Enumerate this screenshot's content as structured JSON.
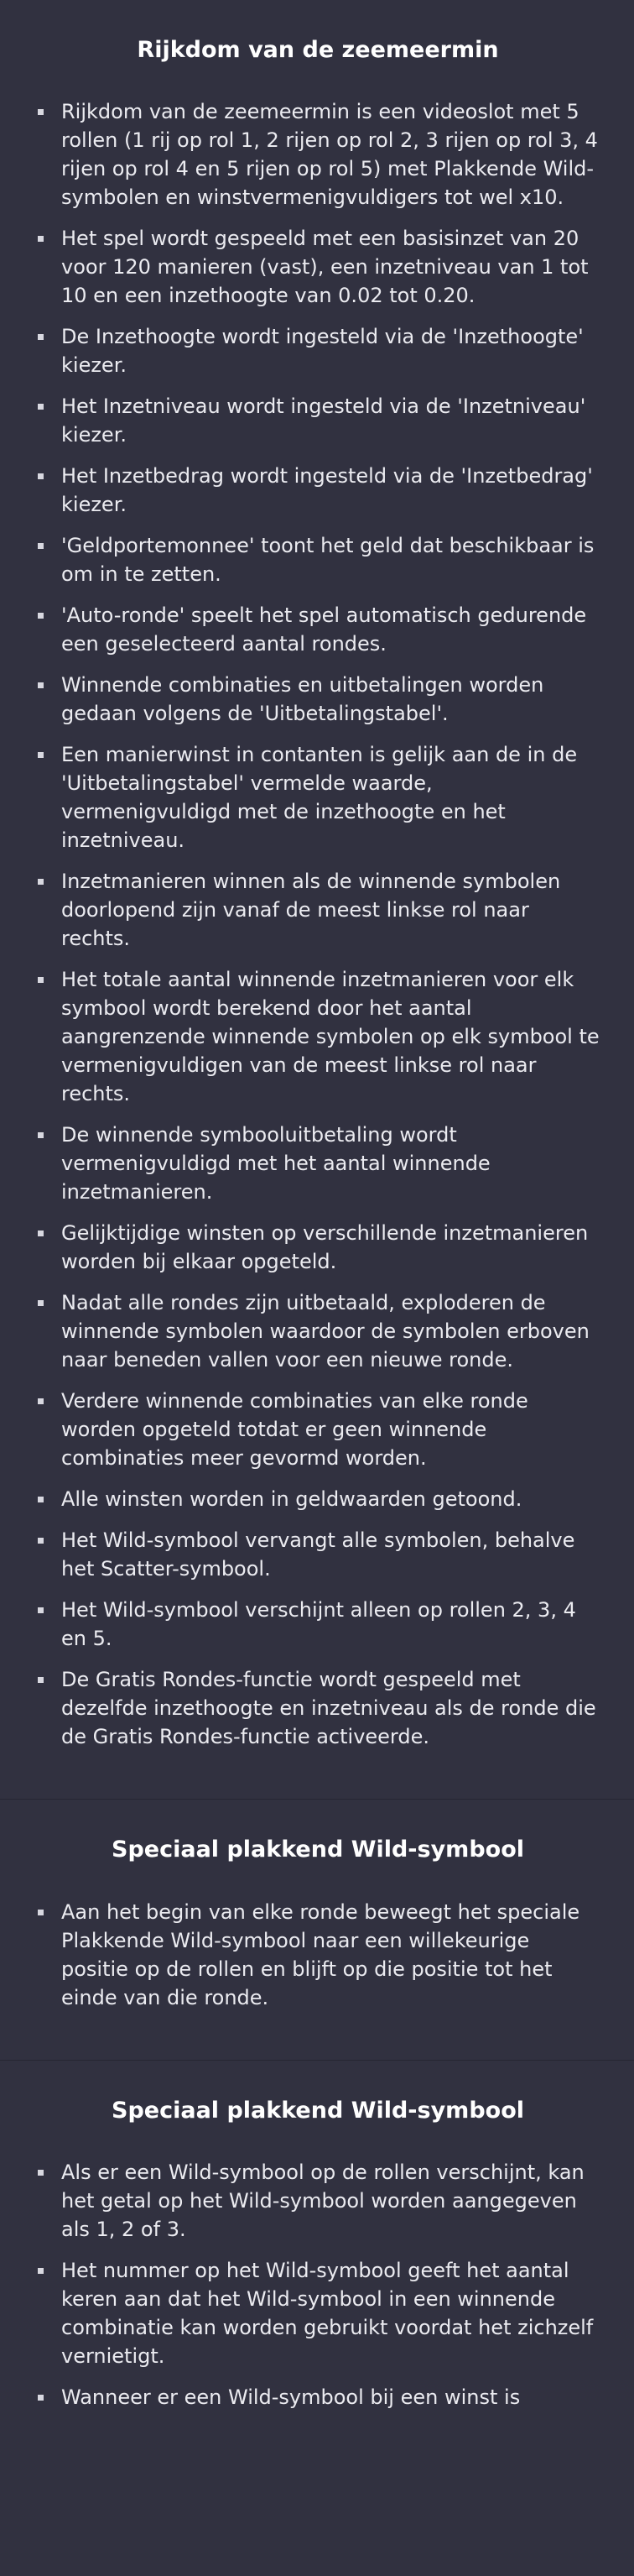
{
  "sections": [
    {
      "title": "Rijkdom van de zeemeermin",
      "items": [
        "Rijkdom van de zeemeermin is een videoslot met 5 rollen (1 rij op rol 1, 2 rijen op rol 2, 3 rijen op rol 3, 4 rijen op rol 4 en 5 rijen op rol 5) met Plakkende Wild-symbolen en winstvermenigvuldigers tot wel x10.",
        "Het spel wordt gespeeld met een basisinzet van 20 voor 120 manieren (vast), een inzetniveau van 1 tot 10 en een inzethoogte van 0.02 tot 0.20.",
        "De Inzethoogte wordt ingesteld via de 'Inzethoogte' kiezer.",
        "Het Inzetniveau wordt ingesteld via de 'Inzetniveau' kiezer.",
        "Het Inzetbedrag wordt ingesteld via de 'Inzetbedrag' kiezer.",
        "'Geldportemonnee' toont het geld dat beschikbaar is om in te zetten.",
        "'Auto-ronde' speelt het spel automatisch gedurende een geselecteerd aantal rondes.",
        "Winnende combinaties en uitbetalingen worden gedaan volgens de 'Uitbetalingstabel'.",
        "Een manierwinst in contanten is gelijk aan de in de 'Uitbetalingstabel' vermelde waarde, vermenigvuldigd met de inzethoogte en het inzetniveau.",
        "Inzetmanieren winnen als de winnende symbolen doorlopend zijn vanaf de meest linkse rol naar rechts.",
        "Het totale aantal winnende inzetmanieren voor elk symbool wordt berekend door het aantal aangrenzende winnende symbolen op elk symbool te vermenigvuldigen van de meest linkse rol naar rechts.",
        "De winnende symbooluitbetaling wordt vermenigvuldigd met het aantal winnende inzetmanieren.",
        "Gelijktijdige winsten op verschillende inzetmanieren worden bij elkaar opgeteld.",
        "Nadat alle rondes zijn uitbetaald, exploderen de winnende symbolen waardoor de symbolen erboven naar beneden vallen voor een nieuwe ronde.",
        "Verdere winnende combinaties van elke ronde worden opgeteld totdat er geen winnende combinaties meer gevormd worden.",
        "Alle winsten worden in geldwaarden getoond.",
        "Het Wild-symbool vervangt alle symbolen, behalve het Scatter-symbool.",
        "Het Wild-symbool verschijnt alleen op rollen 2, 3, 4 en 5.",
        "De Gratis Rondes-functie wordt gespeeld met dezelfde inzethoogte en inzetniveau als de ronde die de Gratis Rondes-functie activeerde."
      ]
    },
    {
      "title": "Speciaal plakkend Wild-symbool",
      "items": [
        "Aan het begin van elke ronde beweegt het speciale Plakkende Wild-symbool naar een willekeurige positie op de rollen en blijft op die positie tot het einde van die ronde."
      ]
    },
    {
      "title": "Speciaal plakkend Wild-symbool",
      "items": [
        "Als er een Wild-symbool op de rollen verschijnt, kan het getal op het Wild-symbool worden aangegeven als 1, 2 of 3.",
        "Het nummer op het Wild-symbool geeft het aantal keren aan dat het Wild-symbool in een winnende combinatie kan worden gebruikt voordat het zichzelf vernietigt.",
        "Wanneer er een Wild-symbool bij een winst is"
      ]
    }
  ]
}
